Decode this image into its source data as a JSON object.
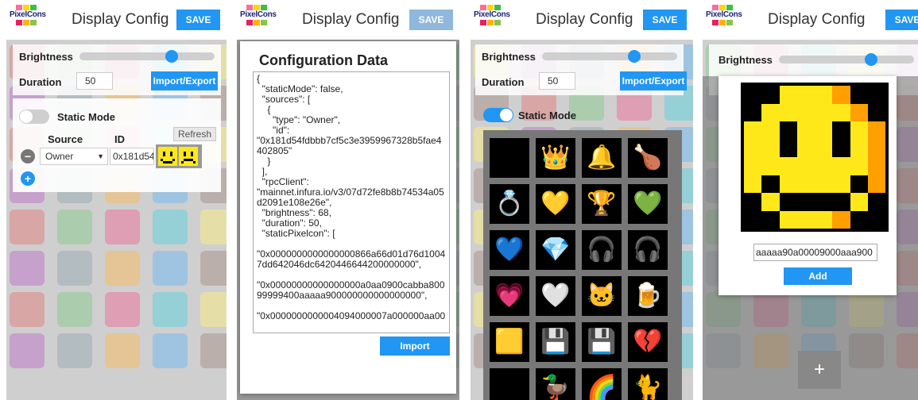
{
  "app": {
    "logo_text": "PixelCons",
    "title": "Display Config",
    "save_label": "SAVE"
  },
  "settings": {
    "brightness_label": "Brightness",
    "brightness_value": 68,
    "duration_label": "Duration",
    "duration_value": "50",
    "import_export_label": "Import/Export",
    "static_mode_label": "Static Mode",
    "static_mode_on": false
  },
  "sources": {
    "source_header": "Source",
    "id_header": "ID",
    "refresh_label": "Refresh",
    "rows": [
      {
        "source": "Owner",
        "id": "0x181d54"
      }
    ],
    "remove_symbol": "−",
    "add_symbol": "+"
  },
  "import_modal": {
    "title": "Configuration Data",
    "json_text": "{\n  \"staticMode\": false,\n  \"sources\": [\n    {\n      \"type\": \"Owner\",\n      \"id\":\n\"0x181d54fdbbb7cf5c3e3959967328b5fae4402805\"\n    }\n  ],\n  \"rpcClient\":\n\"mainnet.infura.io/v3/07d72fe8b8b74534a05d2091e108e26e\",\n  \"brightness\": 68,\n  \"duration\": 50,\n  \"staticPixelcon\": [\n\n\"0x0000000000000000866a66d01d76d10047dd642046dc6420446644200000000\",\n\n\"0x00000000000000000a0aa0900cabba80099999400aaaaa900000000000000000\",\n\n\"0x0000000000004094000007a000000aa00",
    "import_label": "Import"
  },
  "static_view": {
    "static_mode_on": true,
    "icons": [
      {
        "name": "treasure-map-icon",
        "glyph": "🗺"
      },
      {
        "name": "crown-icon",
        "glyph": "👑"
      },
      {
        "name": "bell-icon",
        "glyph": "🔔"
      },
      {
        "name": "drumstick-icon",
        "glyph": "🍗"
      },
      {
        "name": "ring-icon",
        "glyph": "💍"
      },
      {
        "name": "yellow-gem-icon",
        "glyph": "💛"
      },
      {
        "name": "trophy-icon",
        "glyph": "🏆"
      },
      {
        "name": "green-gem-icon",
        "glyph": "💚"
      },
      {
        "name": "sapphire-ring-icon",
        "glyph": "💙"
      },
      {
        "name": "diamond-icon",
        "glyph": "💎"
      },
      {
        "name": "headphones-icon",
        "glyph": "🎧"
      },
      {
        "name": "headphones-dark-icon",
        "glyph": "🎧"
      },
      {
        "name": "pink-gem-icon",
        "glyph": "💗"
      },
      {
        "name": "white-heart-icon",
        "glyph": "🤍"
      },
      {
        "name": "cat-icon",
        "glyph": "🐱"
      },
      {
        "name": "beer-mug-icon",
        "glyph": "🍺"
      },
      {
        "name": "card-icon",
        "glyph": "🟨"
      },
      {
        "name": "floppy-red-icon",
        "glyph": "💾"
      },
      {
        "name": "floppy-blue-icon",
        "glyph": "💾"
      },
      {
        "name": "broken-heart-icon",
        "glyph": "💔"
      },
      {
        "name": "red-heart-icon",
        "glyph": "❤"
      },
      {
        "name": "duck-icon",
        "glyph": "🦆"
      },
      {
        "name": "rainbow-icon",
        "glyph": "🌈"
      },
      {
        "name": "cat-gray-icon",
        "glyph": "🐈"
      }
    ]
  },
  "editor": {
    "hex_value": "aaaaa90a00009000aaa900",
    "add_label": "Add",
    "add_icon_symbol": "+"
  },
  "colors": {
    "accent": "#2196f3",
    "smiley_yellow": "#ffe81a",
    "smiley_orange": "#ff9f00",
    "smiley_black": "#000000"
  }
}
